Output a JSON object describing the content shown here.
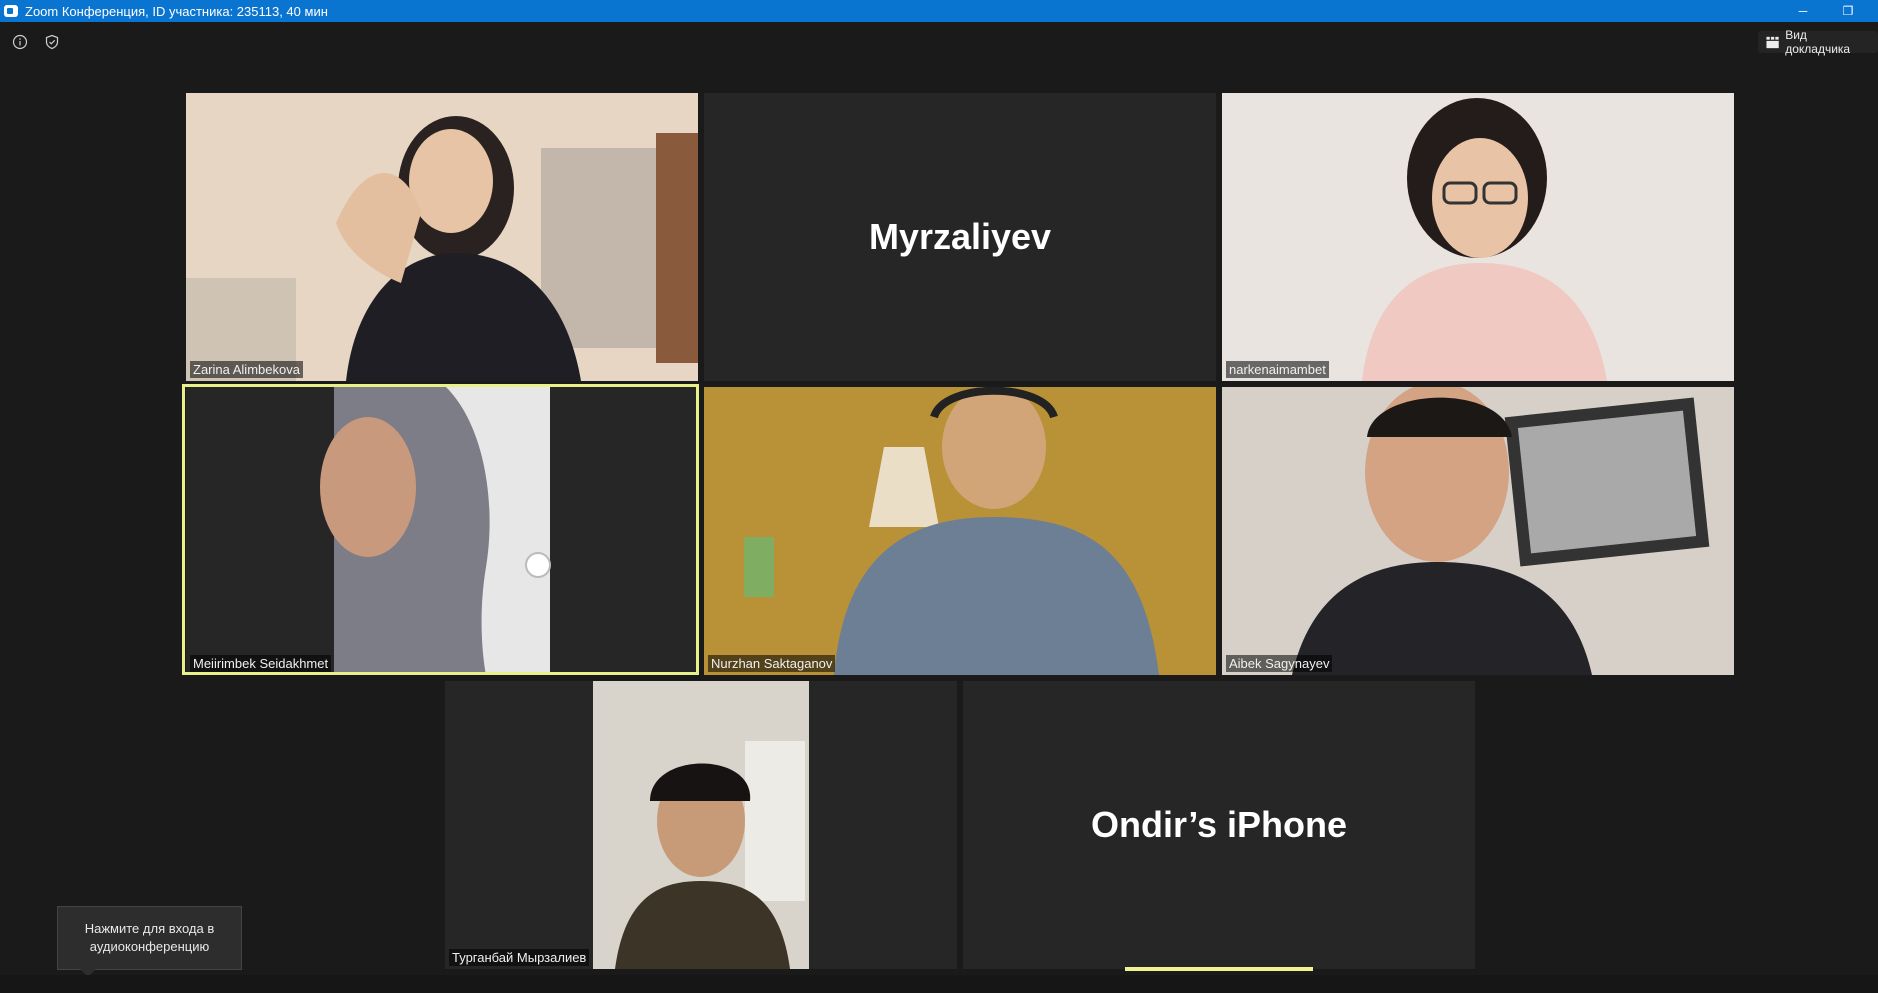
{
  "window": {
    "title": "Zoom Конференция, ID участника: 235113, 40 мин",
    "minimize_glyph": "─",
    "restore_glyph": "❐"
  },
  "toolbar": {
    "info_icon": "info-icon",
    "security_icon": "shield-check-icon",
    "speaker_view_label": "Вид докладчика"
  },
  "participants": [
    {
      "name": "Zarina Alimbekova",
      "video": true
    },
    {
      "name": "Myrzaliyev",
      "video": false,
      "display": "Myrzaliyev"
    },
    {
      "name": "narkenaimambet",
      "video": true
    },
    {
      "name": "Meiirimbek Seidakhmet",
      "video": true,
      "active_speaker": true
    },
    {
      "name": "Nurzhan Saktaganov",
      "video": true
    },
    {
      "name": "Aibek Sagynayev",
      "video": true
    },
    {
      "name": "Турганбай Мырзалиев",
      "video": true
    },
    {
      "name": "Ondir’s iPhone",
      "video": false,
      "display": "Ondir’s iPhone"
    }
  ],
  "audio_tooltip": {
    "line1": "Нажмите для входа в",
    "line2": "аудиоконференцию"
  },
  "colors": {
    "titlebar": "#0a74d1",
    "background": "#1a1a1a",
    "active_speaker_border": "#e8f08a"
  }
}
